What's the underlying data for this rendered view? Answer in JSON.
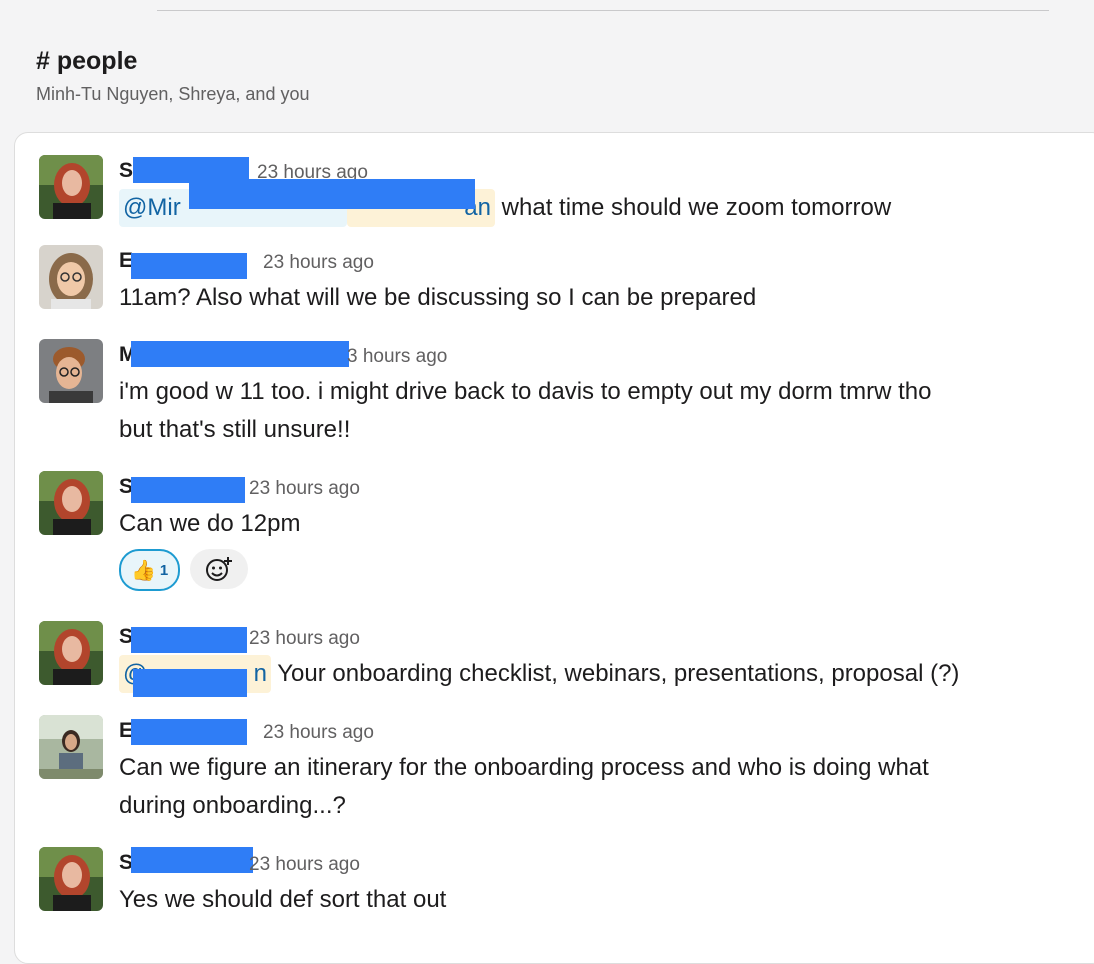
{
  "channel": {
    "name": "# people",
    "members": "Minh-Tu Nguyen, Shreya, and you"
  },
  "messages": [
    {
      "author": "S",
      "time": "23 hours ago",
      "mention_prefix": "@Mir",
      "mention_suffix": "an",
      "text": "what time should we zoom tomorrow"
    },
    {
      "author": "E",
      "time": "23 hours ago",
      "text": "11am? Also what will we be discussing so I can be prepared"
    },
    {
      "author": "M",
      "time": "3 hours ago",
      "text_line1": "i'm good w 11 too. i might drive back to davis to empty out my dorm tmrw tho",
      "text_line2": "but that's still unsure!!"
    },
    {
      "author": "S",
      "time": "23 hours ago",
      "text": "Can we do 12pm",
      "reaction_emoji": "👍",
      "reaction_count": "1"
    },
    {
      "author": "S",
      "time": "23 hours ago",
      "mention_prefix": "@",
      "mention_suffix": "n",
      "text": "Your onboarding checklist, webinars, presentations, proposal (?)"
    },
    {
      "author": "E",
      "time": "23 hours ago",
      "text_line1": "Can we figure an itinerary for the onboarding process and who is doing what",
      "text_line2": "during onboarding...?"
    },
    {
      "author": "S",
      "time": "23 hours ago",
      "text": "Yes we should def sort that out"
    }
  ],
  "icons": {
    "add_reaction": "add-reaction-icon",
    "thumbs_up": "thumbs-up-icon"
  },
  "colors": {
    "redaction": "#2f7df6",
    "mention_text": "#1264a3",
    "mention_bg": "#e8f5fa",
    "mention_bg_highlight": "#fdf2d7"
  }
}
